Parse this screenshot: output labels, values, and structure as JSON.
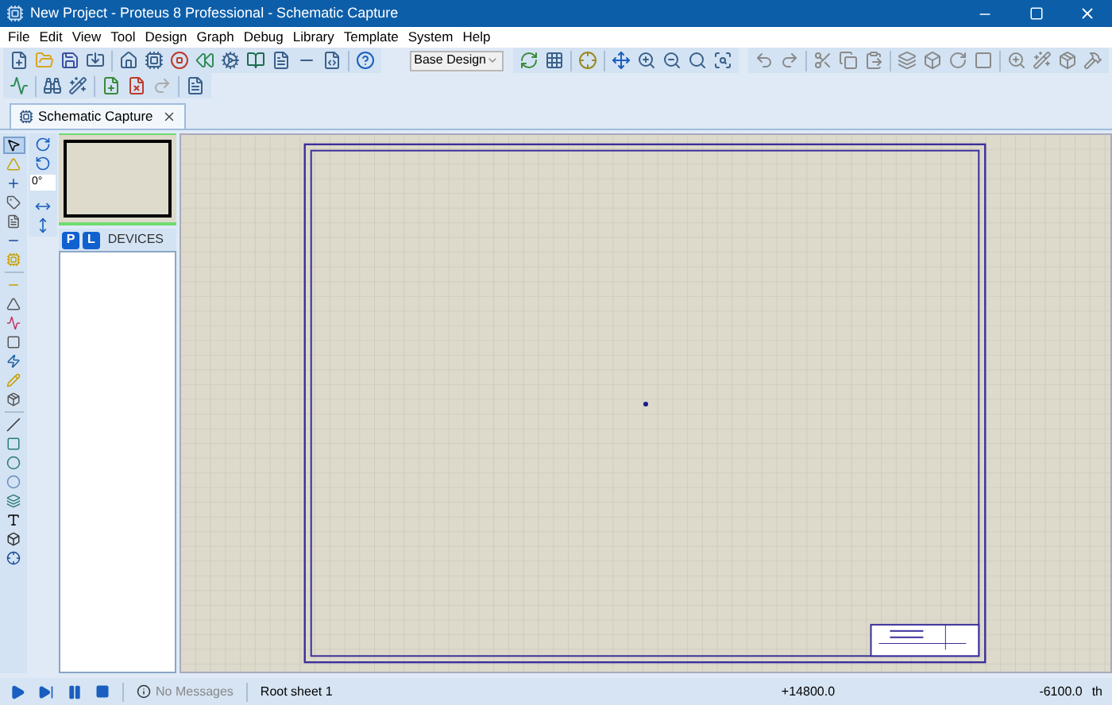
{
  "window": {
    "title": "New Project - Proteus 8 Professional - Schematic Capture"
  },
  "menu": [
    "File",
    "Edit",
    "View",
    "Tool",
    "Design",
    "Graph",
    "Debug",
    "Library",
    "Template",
    "System",
    "Help"
  ],
  "toolbar": {
    "variant_dropdown": {
      "value": "Base Design"
    }
  },
  "tabs": [
    {
      "label": "Schematic Capture",
      "selected": true
    }
  ],
  "rotation_field": {
    "value": "0°"
  },
  "device_panel": {
    "pick_button": "P",
    "library_button": "L",
    "title": "DEVICES"
  },
  "status_bar": {
    "messages": "No Messages",
    "messages_disabled": true,
    "sheet": "Root sheet 1",
    "x_coord": "+14800.0",
    "y_coord": "-6100.0",
    "unit": "th"
  }
}
